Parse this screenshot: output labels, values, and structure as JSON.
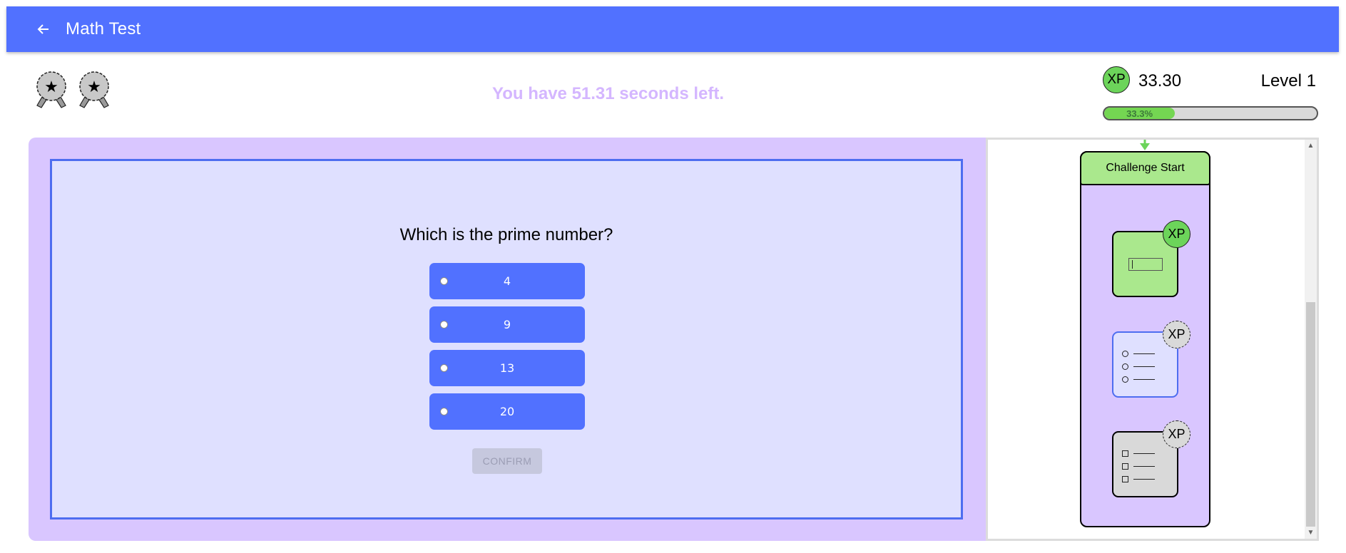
{
  "header": {
    "title": "Math Test",
    "back_icon": "arrow-left-icon",
    "bar_color": "#5171ff"
  },
  "badges": [
    {
      "icon": "award-star-icon"
    },
    {
      "icon": "award-star-icon"
    }
  ],
  "timer": {
    "text": "You have 51.31 seconds left."
  },
  "xp": {
    "chip_label": "XP",
    "value": "33.30",
    "level": "Level 1",
    "progress_label": "33.3%",
    "progress_fraction": 0.333,
    "progress_color": "#74d652"
  },
  "question": {
    "prompt": "Which is the prime number?",
    "options": [
      {
        "label": "4",
        "selected": false
      },
      {
        "label": "9",
        "selected": false
      },
      {
        "label": "13",
        "selected": false
      },
      {
        "label": "20",
        "selected": false
      }
    ],
    "confirm_label": "CONFIRM",
    "confirm_enabled": false
  },
  "flow": {
    "start_label": "Challenge Start",
    "nodes": [
      {
        "type": "text-input",
        "status": "completed",
        "xp_label": "XP",
        "icon": "text-input-icon"
      },
      {
        "type": "single-choice",
        "status": "current",
        "xp_label": "XP",
        "icon": "radio-list-icon"
      },
      {
        "type": "multiple-choice",
        "status": "locked",
        "xp_label": "XP",
        "icon": "checkbox-list-icon"
      }
    ]
  },
  "colors": {
    "main_bg": "#d9c6ff",
    "card_bg": "#dfe0ff",
    "option_bg": "#5171ff",
    "timer_text": "#d4b6ff",
    "completed_green": "#aae88d"
  }
}
